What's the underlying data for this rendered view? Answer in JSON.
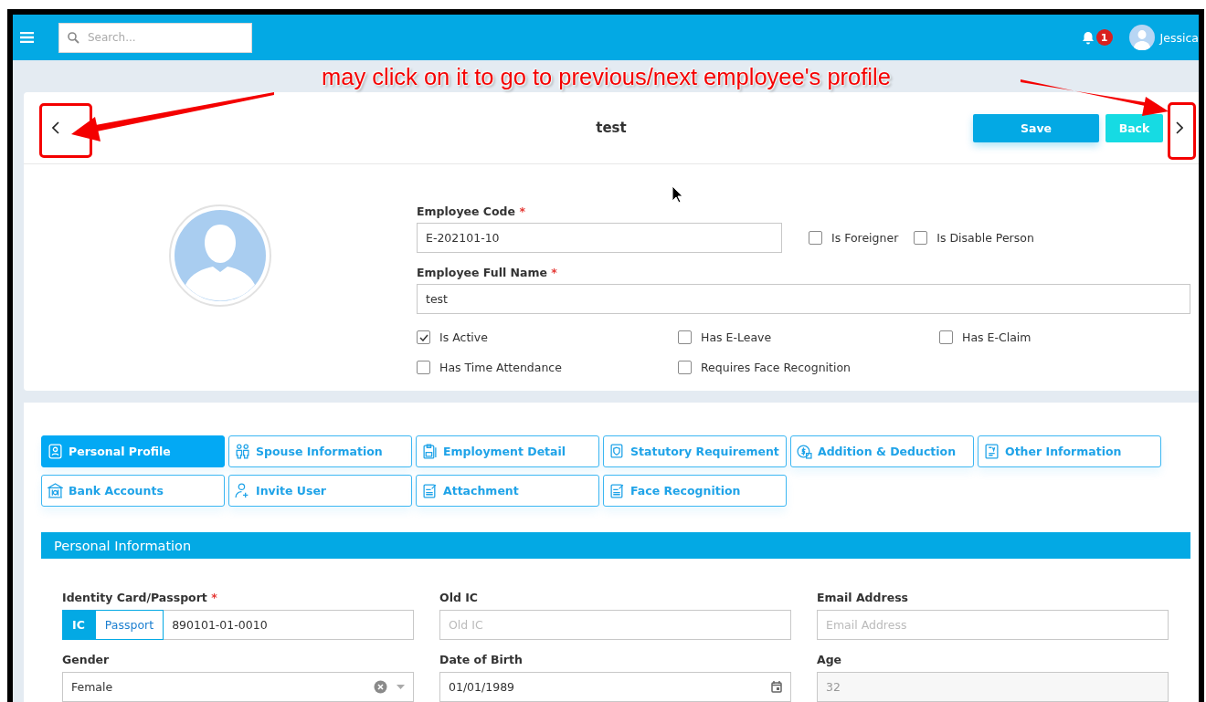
{
  "topbar": {
    "search": {
      "placeholder": "Search..."
    },
    "notification_count": "1",
    "user_name": "Jessica"
  },
  "annotation": {
    "text": "may click on it to go to previous/next employee's profile"
  },
  "header": {
    "title": "test",
    "buttons": [
      {
        "label": "Save",
        "kind": "primary"
      },
      {
        "label": "Back",
        "kind": "secondary"
      }
    ]
  },
  "employee": {
    "required_mark": "*",
    "fields": [
      {
        "label": "Employee Code",
        "required": true,
        "value": "E-202101-10"
      },
      {
        "label": "Employee Full Name",
        "required": true,
        "value": "test"
      }
    ],
    "flags": [
      {
        "label": "Is Foreigner",
        "checked": false
      },
      {
        "label": "Is Disable Person",
        "checked": false
      }
    ],
    "options": [
      {
        "label": "Is Active",
        "checked": true
      },
      {
        "label": "Has E-Leave",
        "checked": false
      },
      {
        "label": "Has E-Claim",
        "checked": false
      },
      {
        "label": "Has Time Attendance",
        "checked": false
      },
      {
        "label": "Requires Face Recognition",
        "checked": false
      }
    ]
  },
  "tabs": [
    {
      "label": "Personal Profile",
      "selected": true
    },
    {
      "label": "Spouse Information",
      "selected": false
    },
    {
      "label": "Employment Detail",
      "selected": false
    },
    {
      "label": "Statutory Requirement",
      "selected": false
    },
    {
      "label": "Addition & Deduction",
      "selected": false
    },
    {
      "label": "Other Information",
      "selected": false
    },
    {
      "label": "Bank Accounts",
      "selected": false
    },
    {
      "label": "Invite User",
      "selected": false
    },
    {
      "label": "Attachment",
      "selected": false
    },
    {
      "label": "Face Recognition",
      "selected": false
    }
  ],
  "section": {
    "title": "Personal Information",
    "fields": [
      {
        "kind": "id",
        "label": "Identity Card/Passport",
        "required": true,
        "options": [
          {
            "label": "IC",
            "selected": true
          },
          {
            "label": "Passport",
            "selected": false
          }
        ],
        "value": "890101-01-0010"
      },
      {
        "kind": "text",
        "label": "Old IC",
        "required": false,
        "placeholder": "Old IC"
      },
      {
        "kind": "text",
        "label": "Email Address",
        "required": false,
        "placeholder": "Email Address"
      },
      {
        "kind": "select",
        "label": "Gender",
        "required": false,
        "value": "Female"
      },
      {
        "kind": "date",
        "label": "Date of Birth",
        "required": false,
        "value": "01/01/1989"
      },
      {
        "kind": "readonly",
        "label": "Age",
        "required": false,
        "value": "32"
      }
    ]
  }
}
